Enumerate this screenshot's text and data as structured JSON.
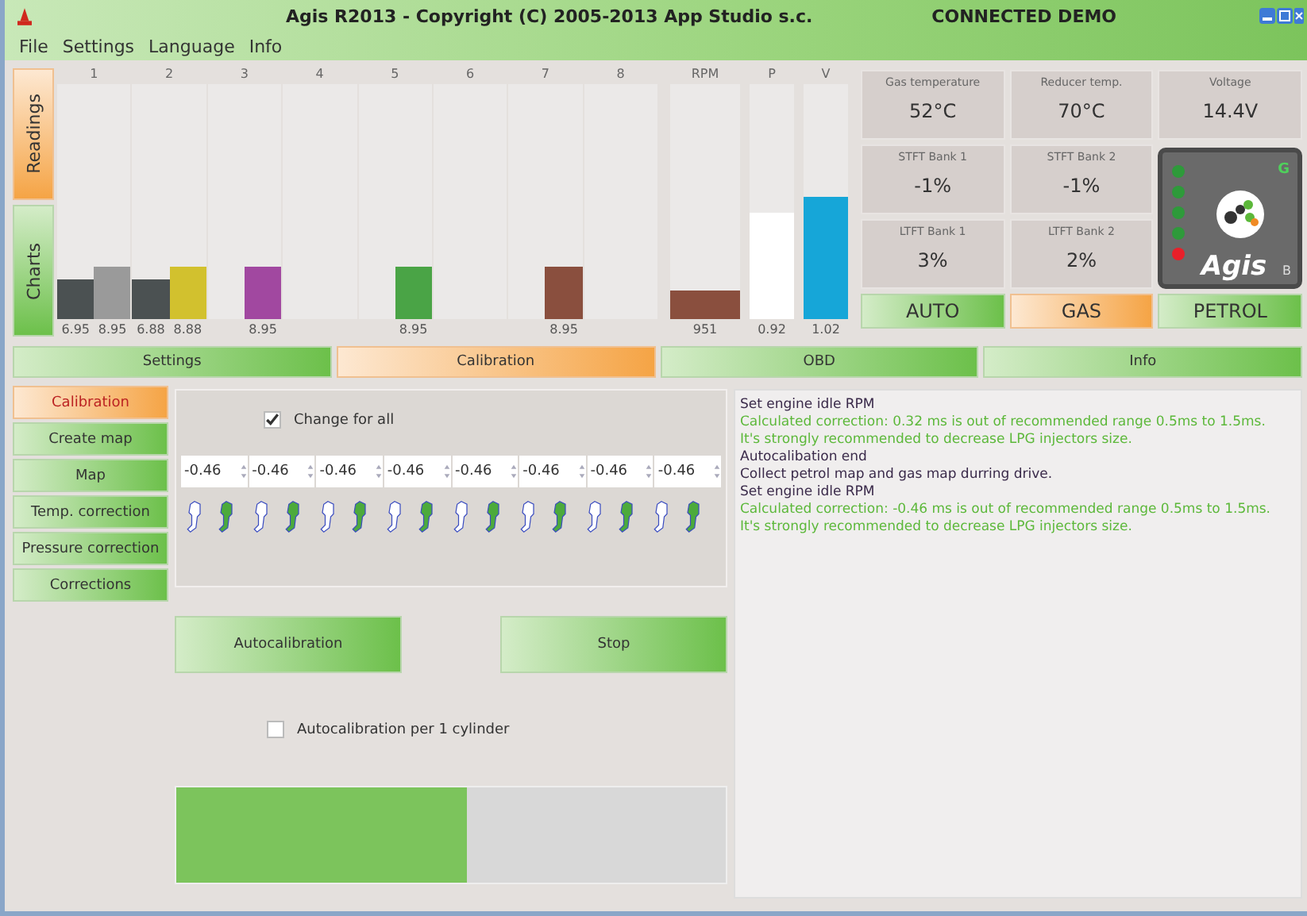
{
  "window": {
    "title": "Agis R2013 - Copyright (C) 2005-2013 App Studio s.c.",
    "status": "CONNECTED DEMO"
  },
  "menu": [
    "File",
    "Settings",
    "Language",
    "Info"
  ],
  "side_tabs": [
    {
      "label": "Readings",
      "selected": true
    },
    {
      "label": "Charts",
      "selected": false
    }
  ],
  "cylinders": [
    {
      "name": "1",
      "bars": [
        {
          "level": 0.17,
          "color": "#4b5152",
          "reading": "6.95"
        },
        {
          "level": 0.22,
          "color": "#9a9a9a",
          "reading": "8.95"
        }
      ]
    },
    {
      "name": "2",
      "bars": [
        {
          "level": 0.17,
          "color": "#4b5152",
          "reading": "6.88"
        },
        {
          "level": 0.22,
          "color": "#d2c12e",
          "reading": "8.88"
        }
      ]
    },
    {
      "name": "3",
      "bars": [
        {
          "level": 0.22,
          "color": "#a148a0",
          "reading": "8.95"
        }
      ]
    },
    {
      "name": "4"
    },
    {
      "name": "5",
      "bars": [
        {
          "level": 0.22,
          "color": "#4aa446",
          "reading": "8.95"
        }
      ]
    },
    {
      "name": "6"
    },
    {
      "name": "7",
      "bars": [
        {
          "level": 0.22,
          "color": "#8a4f3e",
          "reading": "8.95"
        }
      ]
    },
    {
      "name": "8"
    }
  ],
  "gauges": [
    {
      "name": "RPM",
      "level": 0.12,
      "color": "#8a4f3e",
      "reading": "951"
    },
    {
      "name": "P",
      "level": 0.45,
      "color": "#ffffff",
      "reading": "0.92"
    },
    {
      "name": "V",
      "level": 0.52,
      "color": "#16a6d8",
      "reading": "1.02"
    }
  ],
  "readings": [
    {
      "label": "Gas temperature",
      "value": "52°C"
    },
    {
      "label": "Reducer temp.",
      "value": "70°C"
    },
    {
      "label": "Voltage",
      "value": "14.4V"
    },
    {
      "label": "STFT Bank 1",
      "value": "-1%"
    },
    {
      "label": "STFT Bank 2",
      "value": "-1%"
    },
    {
      "label": "LTFT Bank 1",
      "value": "3%"
    },
    {
      "label": "LTFT Bank 2",
      "value": "2%"
    }
  ],
  "controller": {
    "leds": [
      {
        "color": "#2e9a3a"
      },
      {
        "color": "#2e9a3a"
      },
      {
        "color": "#2e9a3a"
      },
      {
        "color": "#2e9a3a"
      },
      {
        "color": "#e8202a"
      }
    ],
    "mode_letter": "G",
    "logo": "Agis",
    "model": "B"
  },
  "modes": [
    {
      "label": "AUTO",
      "selected": false
    },
    {
      "label": "GAS",
      "selected": true
    },
    {
      "label": "PETROL",
      "selected": false
    }
  ],
  "tabs": [
    {
      "label": "Settings",
      "selected": false
    },
    {
      "label": "Calibration",
      "selected": true
    },
    {
      "label": "OBD",
      "selected": false
    },
    {
      "label": "Info",
      "selected": false
    }
  ],
  "submenu": [
    {
      "label": "Calibration",
      "selected": true
    },
    {
      "label": "Create map",
      "selected": false
    },
    {
      "label": "Map",
      "selected": false
    },
    {
      "label": "Temp. correction",
      "selected": false
    },
    {
      "label": "Pressure correction",
      "selected": false
    },
    {
      "label": "Corrections",
      "selected": false
    }
  ],
  "change_for_all": {
    "label": "Change for all",
    "checked": true
  },
  "corrections": [
    "-0.46",
    "-0.46",
    "-0.46",
    "-0.46",
    "-0.46",
    "-0.46",
    "-0.46",
    "-0.46"
  ],
  "buttons": [
    "Autocalibration",
    "Stop"
  ],
  "per_cylinder": {
    "label": "Autocalibration per 1 cylinder",
    "checked": false
  },
  "progress": {
    "level": 0.53
  },
  "log": [
    {
      "kind": "info",
      "text": "Set engine idle RPM"
    },
    {
      "kind": "warning",
      "text": "Calculated correction: 0.32 ms is out of recommended range 0.5ms to 1.5ms."
    },
    {
      "kind": "warning",
      "text": "It's strongly recommended to decrease LPG injectors size."
    },
    {
      "kind": "info",
      "text": "Autocalibation end"
    },
    {
      "kind": "info",
      "text": "Collect petrol map and gas map durring drive."
    },
    {
      "kind": "info",
      "text": "Set engine idle RPM"
    },
    {
      "kind": "warning",
      "text": "Calculated correction: -0.46 ms is out of recommended range 0.5ms to 1.5ms."
    },
    {
      "kind": "warning",
      "text": "It's strongly recommended to decrease LPG injectors size."
    }
  ]
}
